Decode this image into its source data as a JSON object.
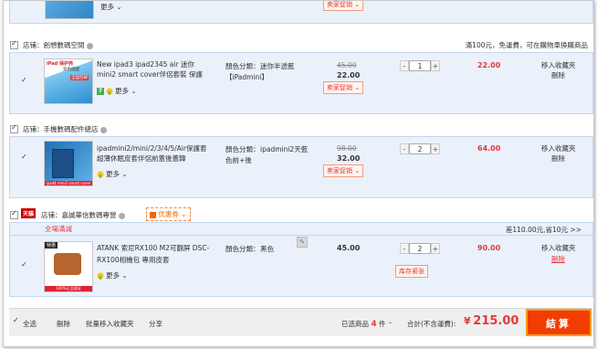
{
  "top_item": {
    "more_label": "更多",
    "promo_label": "卖家促销"
  },
  "shops": [
    {
      "name_label": "店铺：",
      "name": "創想數碼空間",
      "notice": "滿100元，免運費，可在購物車換購商品",
      "item": {
        "title": "New ipad3 ipad2345 air 迷你mini2 smart cover伴侶套裝 保護",
        "thumb_text": [
          "iPad 保护壳",
          "双色搭配",
          "全国包邮"
        ],
        "badge": "7",
        "more_label": "更多",
        "spec_label": "顏色分類：",
        "spec_value": "迷你半透藍【iPadmini】",
        "orig_price": "45.00",
        "price": "22.00",
        "promo_label": "卖家促销",
        "qty": "1",
        "subtotal": "22.00",
        "fav_label": "移入收藏夾",
        "delete_label": "刪除"
      }
    },
    {
      "name_label": "店铺：",
      "name": "手機數碼配件總店",
      "item": {
        "title": "ipadmini2/mini/2/3/4/5/Air保護套超薄休眠皮套伴侶前蓋後蓋韓",
        "thumb_text": [
          "ipad4 mini2 smart cover"
        ],
        "badge": "",
        "more_label": "更多",
        "spec_label": "顏色分類：",
        "spec_value": "ipadmini2天藍色前+後",
        "orig_price": "98.00",
        "price": "32.00",
        "promo_label": "卖家促销",
        "qty": "2",
        "subtotal": "64.00",
        "fav_label": "移入收藏夾",
        "delete_label": "刪除"
      }
    },
    {
      "tmall_label": "天貓",
      "name_label": "店铺：",
      "name": "嘉誠華信數碼專營",
      "coupon_label": "优惠券",
      "discount_tag": "全場滿減",
      "discount_note": "差110.00元,省10元 >>",
      "item": {
        "title": "ATANK 索尼RX100 M2可翻屏 DSC-RX100相機包 專用皮套",
        "thumb_text": [
          "特惠",
          "100%正品保证"
        ],
        "badge": "",
        "more_label": "更多",
        "spec_label": "顏色分類：",
        "spec_value": "黑色",
        "price": "45.00",
        "stock_label": "库存紧张",
        "qty": "2",
        "subtotal": "90.00",
        "fav_label": "移入收藏夾",
        "delete_label": "刪除"
      }
    }
  ],
  "footer": {
    "select_all": "全选",
    "delete": "刪除",
    "batch_fav": "批量移入收藏夾",
    "share": "分享",
    "selected_prefix": "已选商品",
    "selected_count": "4",
    "selected_suffix": "件",
    "total_label": "合計(不含運費):",
    "currency": "¥",
    "total": "215.00",
    "settle": "結算"
  },
  "colors": {
    "accent": "#e4393c",
    "settle_bg": "#f23d00",
    "row_bg": "#eaf1fb"
  }
}
